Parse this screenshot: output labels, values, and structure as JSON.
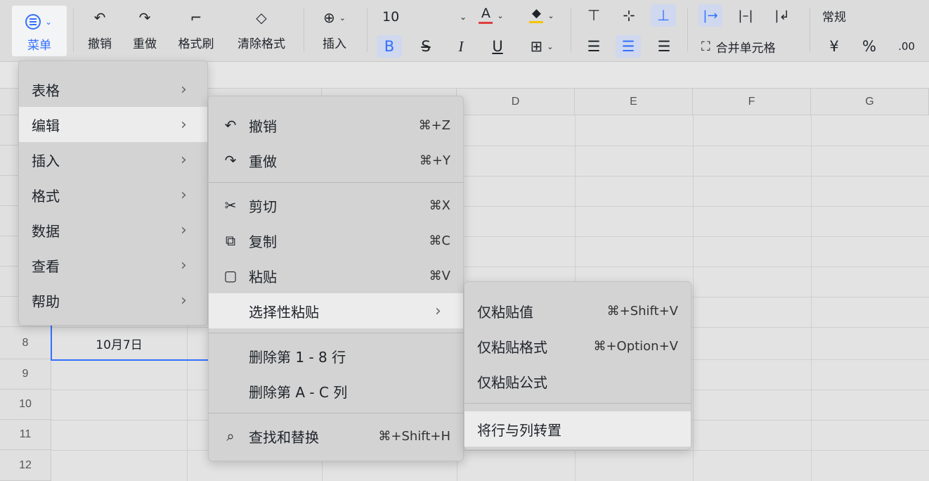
{
  "toolbar": {
    "menu_label": "菜单",
    "undo_label": "撤销",
    "redo_label": "重做",
    "format_painter_label": "格式刷",
    "clear_format_label": "清除格式",
    "insert_label": "插入",
    "font_size": "10",
    "merge_cells_label": "合并单元格",
    "number_format": "常规",
    "currency_symbol": "¥",
    "percent_symbol": "%",
    "decimal_symbol": ".00",
    "accent_color": "#3370ff",
    "font_color_underline": "#e03e3e",
    "fill_color_underline": "#f5c400"
  },
  "sheet": {
    "columns": [
      "D",
      "E",
      "F",
      "G"
    ],
    "rows": [
      "8",
      "9",
      "10",
      "11",
      "12"
    ],
    "cell_b8": "10月7日"
  },
  "main_menu": {
    "items": [
      {
        "label": "表格",
        "icon": "chevron-right-icon"
      },
      {
        "label": "编辑",
        "icon": "chevron-right-icon"
      },
      {
        "label": "插入",
        "icon": "chevron-right-icon"
      },
      {
        "label": "格式",
        "icon": "chevron-right-icon"
      },
      {
        "label": "数据",
        "icon": "chevron-right-icon"
      },
      {
        "label": "查看",
        "icon": "chevron-right-icon"
      },
      {
        "label": "帮助",
        "icon": "chevron-right-icon"
      }
    ]
  },
  "edit_menu": {
    "items": [
      {
        "label": "撤销",
        "shortcut": "⌘+Z",
        "icon": "undo-icon"
      },
      {
        "label": "重做",
        "shortcut": "⌘+Y",
        "icon": "redo-icon"
      },
      {
        "label": "剪切",
        "shortcut": "⌘X",
        "icon": "scissors-icon"
      },
      {
        "label": "复制",
        "shortcut": "⌘C",
        "icon": "copy-icon"
      },
      {
        "label": "粘贴",
        "shortcut": "⌘V",
        "icon": "paste-icon"
      },
      {
        "label": "选择性粘贴",
        "icon": "chevron-right-icon"
      },
      {
        "label": "删除第 1 - 8 行"
      },
      {
        "label": "删除第 A - C 列"
      },
      {
        "label": "查找和替换",
        "shortcut": "⌘+Shift+H",
        "icon": "find-replace-icon"
      }
    ]
  },
  "paste_special_menu": {
    "items": [
      {
        "label": "仅粘贴值",
        "shortcut": "⌘+Shift+V"
      },
      {
        "label": "仅粘贴格式",
        "shortcut": "⌘+Option+V"
      },
      {
        "label": "仅粘贴公式"
      },
      {
        "label": "将行与列转置"
      }
    ]
  }
}
